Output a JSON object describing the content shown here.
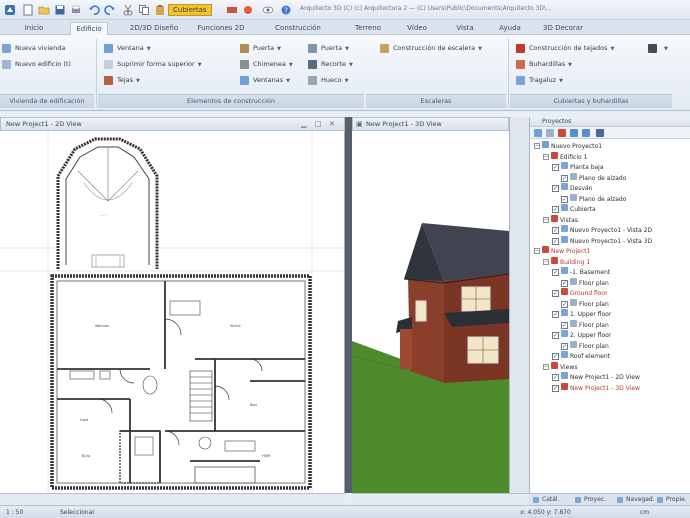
{
  "title_bar": {
    "project_label": "Cubiertas",
    "window_title": "Arquitecto 3D (C) (c) Arquitectura 2 — (C) Users\\Public\\Documents\\Arquitecto 3D\\..."
  },
  "tabs": [
    "Inicio",
    "Edificio",
    "2D/3D Diseño",
    "Funciones 2D",
    "Construcción",
    "Terreno",
    "Vídeo",
    "Vista",
    "Ayuda",
    "3D Decorar"
  ],
  "active_tab": "Edificio",
  "ribbon": {
    "group1": {
      "items": [
        "Nueva vivienda",
        "Nuevo edificio (t)"
      ],
      "label": "Vivienda de edificación"
    },
    "group2": {
      "col1": [
        "Ventana",
        "Suprimir forma superior",
        "Tejas"
      ],
      "col2": [
        "Puerta",
        "Chimenea",
        "Ventanas"
      ],
      "col3": [
        "Puerta",
        "Recorte",
        "Hueco"
      ],
      "col4": [
        "Construcción de escalera"
      ],
      "label_left": "Elementos de construcción",
      "label_right": "Escaleras"
    },
    "group3": {
      "items": [
        "Construcción de tejados",
        "Buhardillas",
        "Tragaluz"
      ],
      "label": "Cubiertas y buhardillas"
    }
  },
  "views": {
    "plan_title": "New Project1 - 2D View",
    "view3d_title": "New Project1 - 3D View"
  },
  "panel": {
    "title": "Proyectos",
    "tree": [
      {
        "label": "Nuevo Proyecto1",
        "indent": 0,
        "type": "expand",
        "red": false
      },
      {
        "label": "Edificio 1",
        "indent": 1,
        "type": "expand",
        "red": false
      },
      {
        "label": "Planta baja",
        "indent": 2,
        "type": "check",
        "red": false
      },
      {
        "label": "Plano de alzado",
        "indent": 3,
        "type": "check",
        "red": false
      },
      {
        "label": "Desván",
        "indent": 2,
        "type": "check",
        "red": false
      },
      {
        "label": "Plano de alzado",
        "indent": 3,
        "type": "check",
        "red": false
      },
      {
        "label": "Cubierta",
        "indent": 2,
        "type": "check",
        "red": false
      },
      {
        "label": "Vistas",
        "indent": 1,
        "type": "expand",
        "red": false
      },
      {
        "label": "Nuevo Proyecto1 - Vista 2D",
        "indent": 2,
        "type": "check",
        "red": false
      },
      {
        "label": "Nuevo Proyecto1 - Vista 3D",
        "indent": 2,
        "type": "check",
        "red": false
      },
      {
        "label": "New Project1",
        "indent": 0,
        "type": "expand",
        "red": true
      },
      {
        "label": "Building 1",
        "indent": 1,
        "type": "expand",
        "red": true
      },
      {
        "label": "-1. Basement",
        "indent": 2,
        "type": "check",
        "red": false
      },
      {
        "label": "Floor plan",
        "indent": 3,
        "type": "check",
        "red": false
      },
      {
        "label": "Ground floor",
        "indent": 2,
        "type": "check",
        "red": true
      },
      {
        "label": "Floor plan",
        "indent": 3,
        "type": "check",
        "red": false
      },
      {
        "label": "1. Upper floor",
        "indent": 2,
        "type": "check",
        "red": false
      },
      {
        "label": "Floor plan",
        "indent": 3,
        "type": "check",
        "red": false
      },
      {
        "label": "2. Upper floor",
        "indent": 2,
        "type": "check",
        "red": false
      },
      {
        "label": "Floor plan",
        "indent": 3,
        "type": "check",
        "red": false
      },
      {
        "label": "Roof element",
        "indent": 2,
        "type": "check",
        "red": false
      },
      {
        "label": "Views",
        "indent": 1,
        "type": "expand",
        "red": false
      },
      {
        "label": "New Project1 - 2D View",
        "indent": 2,
        "type": "check",
        "red": false
      },
      {
        "label": "New Project1 - 3D View",
        "indent": 2,
        "type": "check",
        "red": true
      }
    ],
    "bottom_tabs": [
      "Catál.",
      "Proyec.",
      "Navegad.",
      "Propie."
    ]
  },
  "status": {
    "scale": "1 : 50",
    "coords": "x: 4.050 y: 7.870",
    "mode": "Seleccionar",
    "extra": "cm"
  },
  "colors": {
    "accent": "#f0c23a",
    "tree_red": "#b5392e",
    "grass": "#4f8a2c",
    "brick": "#8a3f2a",
    "roof": "#3f4450",
    "sky": "#ffffff"
  }
}
